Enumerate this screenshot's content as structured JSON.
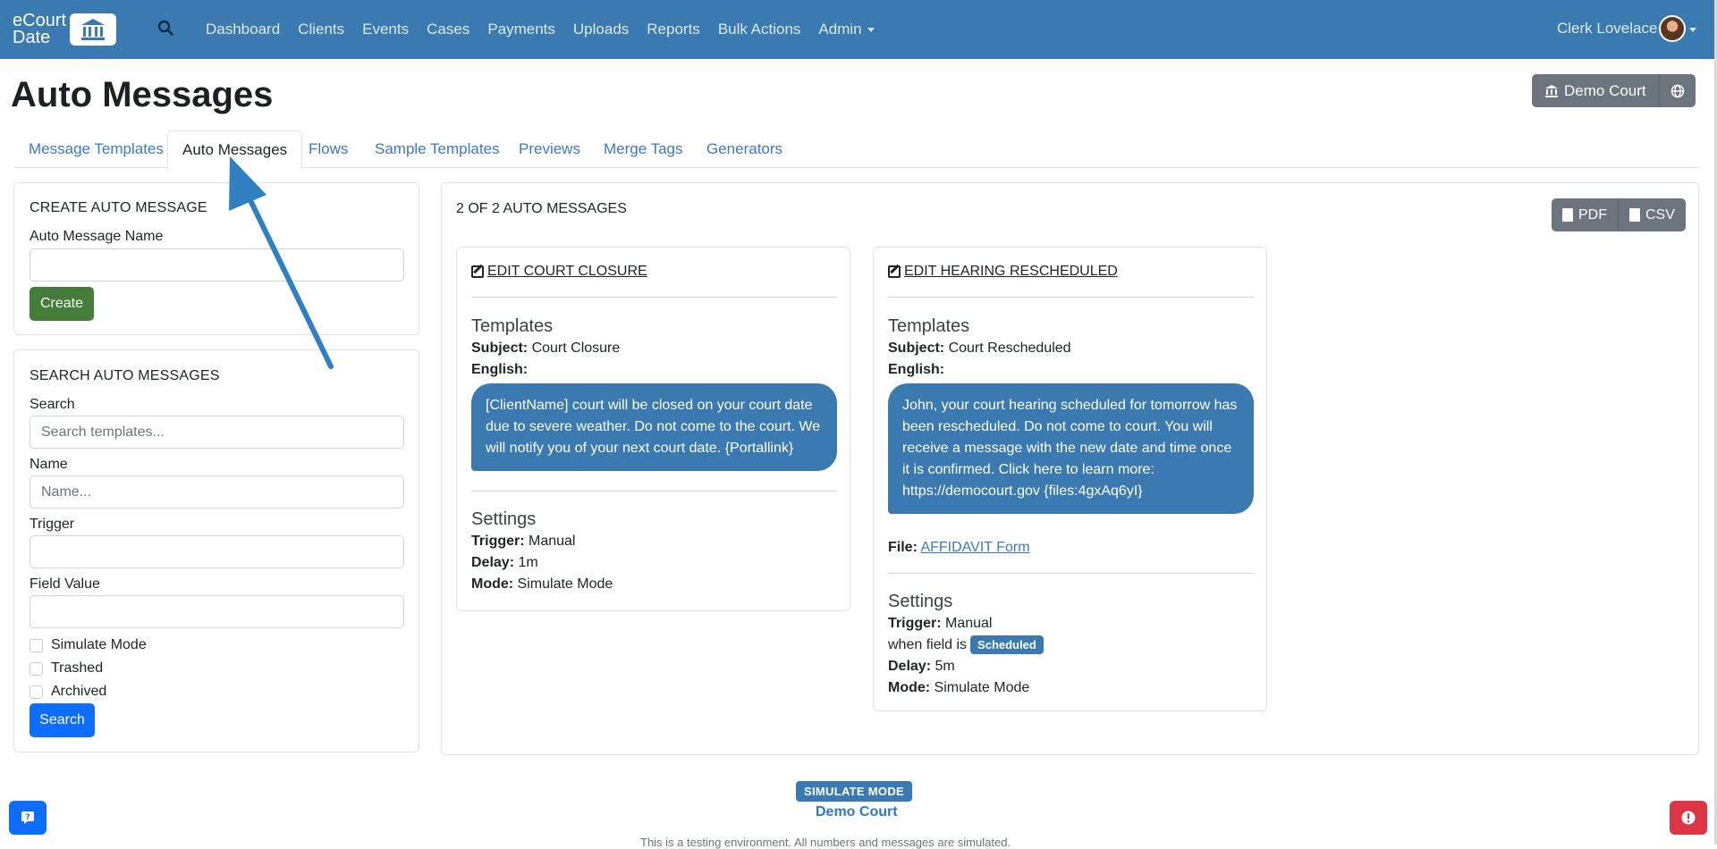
{
  "navbar": {
    "brand_line1": "eCourt",
    "brand_line2": "Date",
    "links": [
      "Dashboard",
      "Clients",
      "Events",
      "Cases",
      "Payments",
      "Uploads",
      "Reports",
      "Bulk Actions",
      "Admin"
    ],
    "user_name": "Clerk Lovelace"
  },
  "header": {
    "title": "Auto Messages",
    "court_button": "Demo Court"
  },
  "tabs": [
    {
      "label": "Message Templates",
      "active": false
    },
    {
      "label": "Auto Messages",
      "active": true
    },
    {
      "label": "Flows",
      "active": false
    },
    {
      "label": "Sample Templates",
      "active": false
    },
    {
      "label": "Previews",
      "active": false
    },
    {
      "label": "Merge Tags",
      "active": false
    },
    {
      "label": "Generators",
      "active": false
    }
  ],
  "create": {
    "heading": "CREATE AUTO MESSAGE",
    "name_label": "Auto Message Name",
    "name_value": "",
    "button": "Create"
  },
  "search": {
    "heading": "SEARCH AUTO MESSAGES",
    "search_label": "Search",
    "search_placeholder": "Search templates...",
    "name_label": "Name",
    "name_placeholder": "Name...",
    "trigger_label": "Trigger",
    "trigger_value": "",
    "field_value_label": "Field Value",
    "field_value_value": "",
    "checkboxes": [
      "Simulate Mode",
      "Trashed",
      "Archived"
    ],
    "button": "Search"
  },
  "results": {
    "count_label": "2 OF 2 AUTO MESSAGES",
    "export_pdf": "PDF",
    "export_csv": "CSV",
    "cards": [
      {
        "edit_label": " EDIT COURT CLOSURE",
        "templates_heading": "Templates",
        "subject_key": "Subject:",
        "subject_value": " Court Closure",
        "language_key": "English:",
        "message": "[ClientName] court will be closed on your court date due to severe weather. Do not come to the court. We will notify you of your next court date. {Portallink}",
        "settings_heading": "Settings",
        "trigger_key": "Trigger:",
        "trigger_value": " Manual",
        "delay_key": "Delay:",
        "delay_value": " 1m",
        "mode_key": "Mode:",
        "mode_value": " Simulate Mode"
      },
      {
        "edit_label": " EDIT HEARING RESCHEDULED",
        "templates_heading": "Templates",
        "subject_key": "Subject:",
        "subject_value": " Court Rescheduled",
        "language_key": "English:",
        "message": "John, your court hearing scheduled for tomorrow has been rescheduled. Do not come to court. You will receive a message with the new date and time once it is confirmed. Click here to learn more: https://democourt.gov {files:4gxAq6yI}",
        "file_key": "File:",
        "file_link": "AFFIDAVIT Form",
        "settings_heading": "Settings",
        "trigger_key": "Trigger:",
        "trigger_value": " Manual",
        "when_field_text": "when field is",
        "when_field_value": "Scheduled",
        "delay_key": "Delay:",
        "delay_value": " 5m",
        "mode_key": "Mode:",
        "mode_value": " Simulate Mode"
      }
    ]
  },
  "footer": {
    "simulate_badge": "SIMULATE MODE",
    "court_name": "Demo Court",
    "note_cut": "This is a testing environment. All numbers and messages are simulated."
  },
  "colors": {
    "navbar": "#3a7ab0",
    "primary": "#0d6efd",
    "create_button": "#447c3a",
    "annotation_arrow": "#2f7fc1",
    "alert_button": "#dc3545"
  }
}
